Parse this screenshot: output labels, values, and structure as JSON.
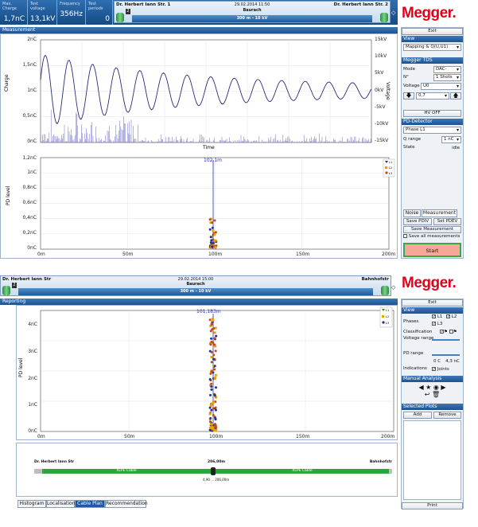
{
  "top": {
    "stats": [
      {
        "label": "Max. Charge",
        "value": "1,7nC"
      },
      {
        "label": "Test voltage",
        "value": "13,1kV"
      },
      {
        "label": "Frequency",
        "value": "356Hz"
      },
      {
        "label": "Test periods",
        "value": "0"
      }
    ],
    "route": {
      "left": "Dr. Herbert Iann Str. 1",
      "flag": "2",
      "date": "29.02.2014 11:50",
      "place": "Baurach",
      "right": "Dr. Herbert Iann Str. 2",
      "bar": "300 m - 10 kV"
    },
    "diamond": "◇",
    "section": "Measurement",
    "charge_axis": {
      "label": "Charge",
      "ticks": [
        "2nC",
        "1,5nC",
        "1nC",
        "0,5nC",
        "0nC"
      ]
    },
    "voltage_axis": {
      "label": "Voltage",
      "ticks": [
        "15kV",
        "10kV",
        "5kV",
        "0kV",
        "-5kV",
        "-10kV",
        "-15kV"
      ]
    },
    "time_label": "Time",
    "pd_axis": {
      "label": "PD level",
      "ticks": [
        "1,2nC",
        "1nC",
        "0,8nC",
        "0,6nC",
        "0,4nC",
        "0,2nC",
        "0nC"
      ]
    },
    "x_ticks": [
      "0m",
      "50m",
      "100m",
      "150m",
      "200m"
    ],
    "marker": "102,1m",
    "legend": [
      "L1",
      "L2",
      "L3"
    ],
    "sidebar": {
      "exit": "Exit",
      "view_hdr": "View",
      "view_select": "Mapping & Q(U,U1)",
      "tds_hdr": "Megger TDS",
      "mode_label": "Mode",
      "mode_value": "DAC-",
      "n_label": "N°",
      "n_value": "1 Shots",
      "voltage_label": "Voltage",
      "voltage_value": "U0",
      "voltage_num": "0,7",
      "hv": "HV OFF",
      "pd_hdr": "PD-Detector",
      "phase_value": "Phase L1",
      "qrange_label": "Q range",
      "qrange_value": "1 nC",
      "state_label": "State",
      "state_value": "idle",
      "tab_noise": "Noise",
      "tab_meas": "Measurement",
      "save_pdiv": "Save PDIV",
      "set_pdev": "Set PDEV",
      "save_meas": "Save Measurement",
      "save_all": "Save all measurements",
      "start": "Start"
    }
  },
  "bottom": {
    "route": {
      "left": "Dr. Herbert Iann Str",
      "flag": "2",
      "date": "29.02.2014 15:00",
      "place": "Baurach",
      "right": "Bahnhofstr",
      "bar": "300 m - 10 kV"
    },
    "diamond": "◇",
    "section": "Reporting",
    "pd_axis": {
      "label": "PD level",
      "ticks": [
        "4nC",
        "3nC",
        "2nC",
        "1nC",
        "0nC"
      ]
    },
    "x_ticks": [
      "0m",
      "50m",
      "100m",
      "150m",
      "200m"
    ],
    "marker": "101,183m",
    "legend": [
      "L1",
      "L2",
      "L3"
    ],
    "cable": {
      "left": "Dr. Herbert Iann Str",
      "mid": "206,00m",
      "right": "Bahnhofstr",
      "seg1": "XLPE Cable",
      "seg2": "XLPE Cable",
      "range": "4,90 ... 206,00m"
    },
    "tabs": [
      "Histogram",
      "Localisation",
      "Cable Plan",
      "Recommendation"
    ],
    "sidebar": {
      "exit": "Exit",
      "view_hdr": "View",
      "phases_label": "Phases",
      "ph1": "L1",
      "ph2": "L2",
      "ph3": "L3",
      "class_label": "Classification",
      "vrange_label": "Voltage range",
      "pdrange_label": "PD range",
      "pd_min": "0 C",
      "pd_max": "4,3 nC",
      "ind_label": "Indications",
      "joints": "Joints",
      "ma_hdr": "Manual Analysis",
      "sel_hdr": "Selected Plots",
      "add": "Add",
      "remove": "Remove",
      "print": "Print"
    }
  },
  "logo": "Megger."
}
